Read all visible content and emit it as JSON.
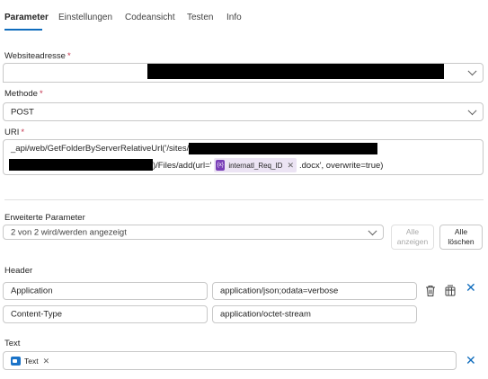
{
  "tabs": [
    {
      "label": "Parameter",
      "active": true
    },
    {
      "label": "Einstellungen",
      "active": false
    },
    {
      "label": "Codeansicht",
      "active": false
    },
    {
      "label": "Testen",
      "active": false
    },
    {
      "label": "Info",
      "active": false
    }
  ],
  "website": {
    "label": "Websiteadresse",
    "required": "*"
  },
  "method": {
    "label": "Methode",
    "required": "*",
    "value": "POST"
  },
  "uri": {
    "label": "URI",
    "required": "*",
    "line1": "_api/web/GetFolderByServerRelativeUrl('/sites/",
    "line2_mid": ")/Files/add(url='",
    "token_icon": "{x}",
    "token_text": "internatl_Req_ID",
    "line2_tail": ".docx', overwrite=true)"
  },
  "advanced": {
    "label": "Erweiterte Parameter",
    "value": "2 von 2 wird/werden angezeigt",
    "show_all_line1": "Alle",
    "show_all_line2": "anzeigen",
    "clear_all_line1": "Alle",
    "clear_all_line2": "löschen"
  },
  "header": {
    "label": "Header",
    "rows": [
      {
        "key": "Application",
        "value": "application/json;odata=verbose"
      },
      {
        "key": "Content-Type",
        "value": "application/octet-stream"
      }
    ]
  },
  "text": {
    "label": "Text",
    "chip": "Text"
  },
  "icons": {
    "chevron": "chevron-down-icon",
    "delete": "trash-icon",
    "switch": "switch-mode-icon",
    "close": "close-icon",
    "variable": "variable-icon",
    "word": "word-icon"
  },
  "colors": {
    "accent": "#0f6cbd",
    "required": "#c4314b",
    "token_bg": "#ece4f4",
    "token_icon": "#7a3fb8"
  }
}
